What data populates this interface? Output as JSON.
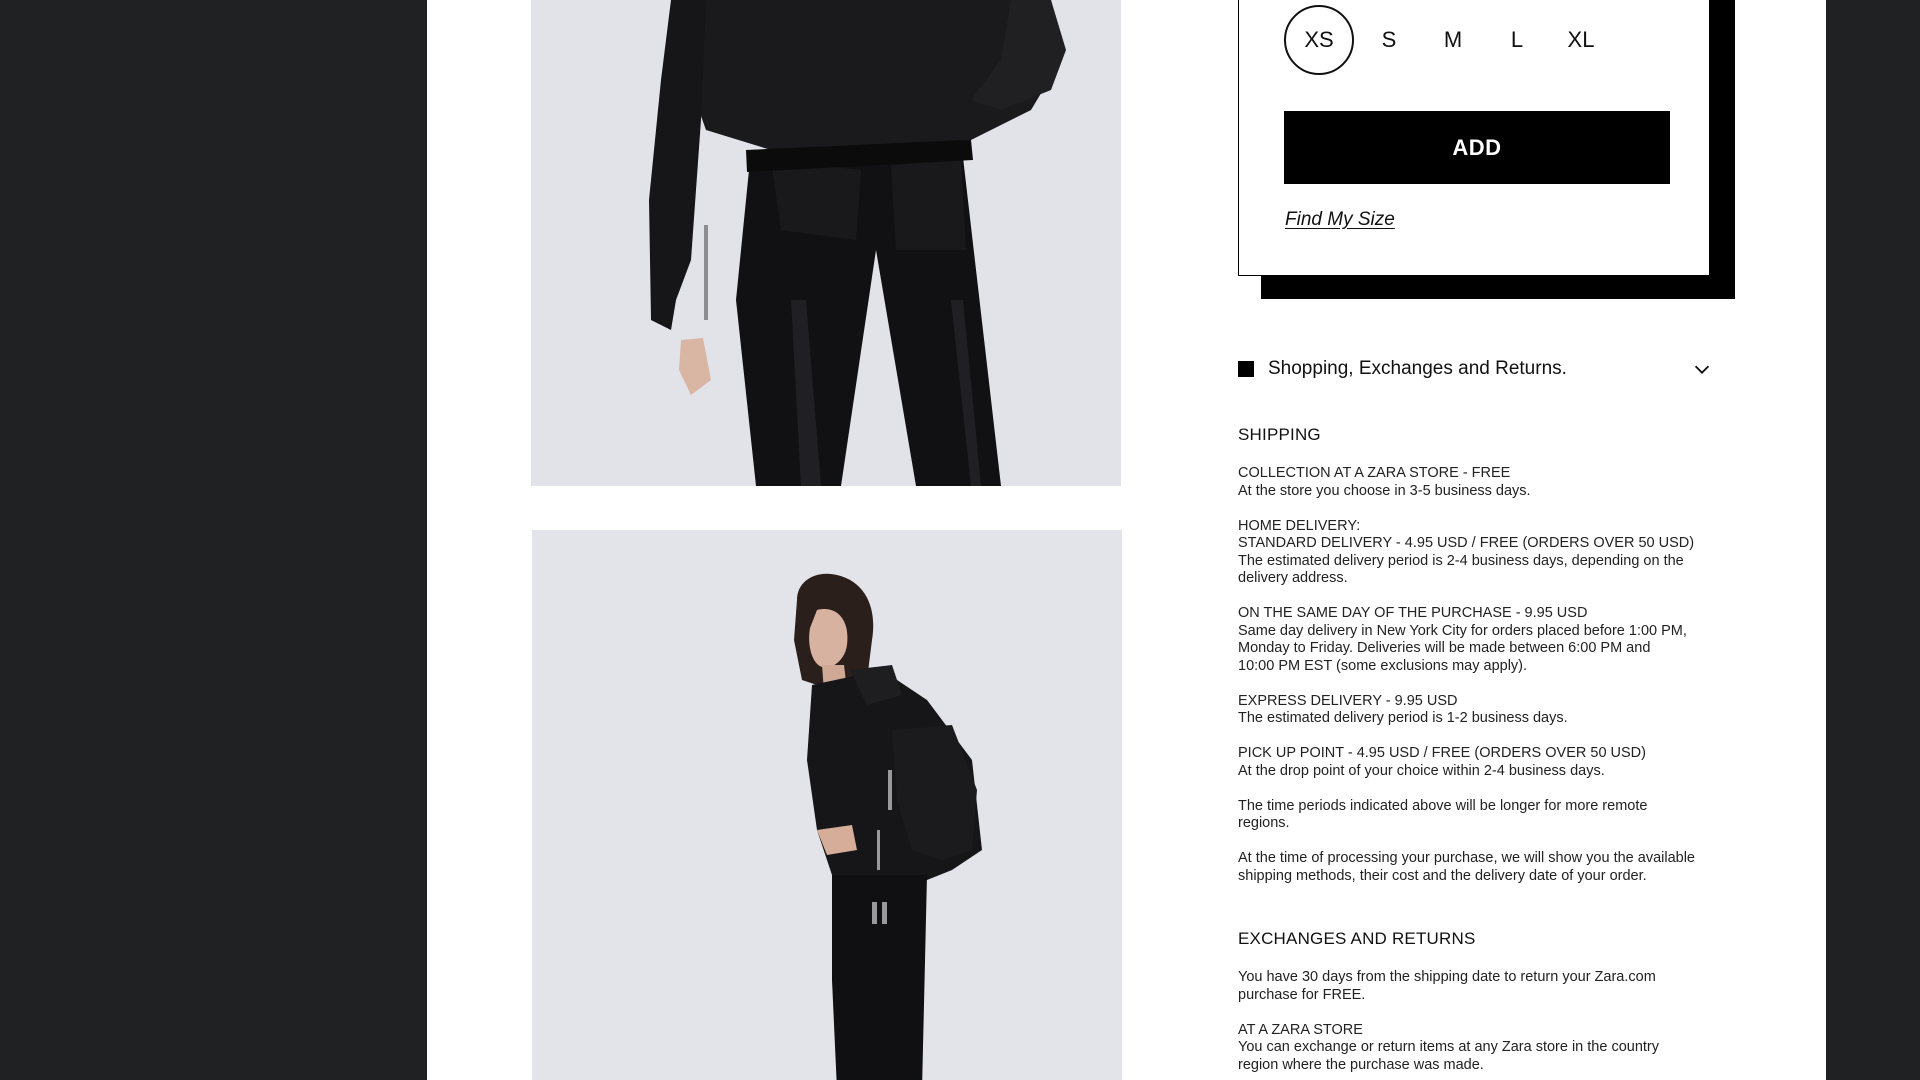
{
  "sizes": {
    "options": [
      "XS",
      "S",
      "M",
      "L",
      "XL"
    ],
    "selected": "XS"
  },
  "add_button": "ADD",
  "find_size_link": "Find My Size",
  "accordion": {
    "label": "Shopping, Exchanges and Returns.",
    "icon": "chevron-down-icon"
  },
  "shipping": {
    "title": "SHIPPING",
    "blocks": [
      {
        "heading": "COLLECTION AT A ZARA STORE - FREE",
        "lines": [
          "At the store you choose in 3-5 business days."
        ]
      },
      {
        "heading": "HOME DELIVERY:",
        "lines": [
          "STANDARD DELIVERY - 4.95 USD / FREE (ORDERS OVER 50 USD)",
          "The estimated delivery period is 2-4 business days, depending on the",
          "delivery address."
        ]
      },
      {
        "heading": "ON THE SAME DAY OF THE PURCHASE - 9.95 USD",
        "lines": [
          "Same day delivery in New York City for orders placed before 1:00 PM,",
          "Monday to Friday. Deliveries will be made between 6:00 PM and",
          "10:00 PM EST (some exclusions may apply)."
        ]
      },
      {
        "heading": "EXPRESS DELIVERY - 9.95 USD",
        "lines": [
          "The estimated delivery period is 1-2 business days."
        ]
      },
      {
        "heading": "PICK UP POINT - 4.95 USD / FREE (ORDERS OVER 50 USD)",
        "lines": [
          "At the drop point of your choice within 2-4 business days."
        ]
      },
      {
        "heading": "The time periods indicated above will be longer for more remote",
        "lines": [
          "regions."
        ]
      },
      {
        "heading": "At the time of processing your purchase, we will show you the available",
        "lines": [
          "shipping methods, their cost and the delivery date of your order."
        ]
      }
    ]
  },
  "returns": {
    "title": "EXCHANGES AND RETURNS",
    "blocks": [
      {
        "heading": "You have 30 days from the shipping date to return your Zara.com",
        "lines": [
          "purchase for FREE."
        ]
      },
      {
        "heading": "AT A ZARA STORE",
        "lines": [
          "You can exchange or return items at any Zara store in the  country",
          "region where the purchase was made."
        ]
      }
    ]
  }
}
